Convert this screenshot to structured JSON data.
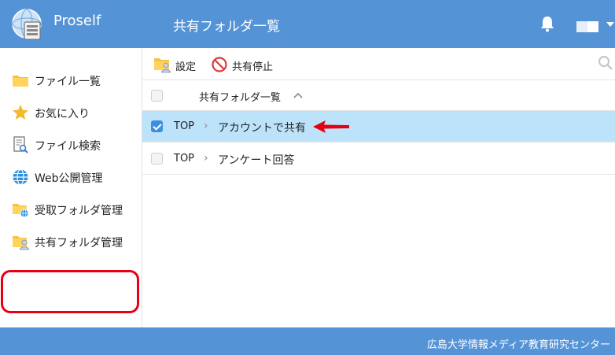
{
  "header": {
    "brand": "Proself",
    "title": "共有フォルダ一覧",
    "bg_color": "#5593d7"
  },
  "sidebar": {
    "items": [
      {
        "label": "ファイル一覧",
        "icon": "folder-icon"
      },
      {
        "label": "お気に入り",
        "icon": "star-icon"
      },
      {
        "label": "ファイル検索",
        "icon": "file-search-icon"
      },
      {
        "label": "Web公開管理",
        "icon": "globe-icon"
      },
      {
        "label": "受取フォルダ管理",
        "icon": "folder-globe-icon"
      },
      {
        "label": "共有フォルダ管理",
        "icon": "shared-folder-icon"
      }
    ],
    "highlight_color": "#e60012"
  },
  "toolbar": {
    "settings_label": "設定",
    "stop_sharing_label": "共有停止"
  },
  "list": {
    "column_title": "共有フォルダ一覧",
    "rows": [
      {
        "root": "TOP",
        "name": "アカウントで共有",
        "checked": true
      },
      {
        "root": "TOP",
        "name": "アンケート回答",
        "checked": false
      }
    ],
    "selected_color": "#bde3fb"
  },
  "footer": {
    "text": "広島大学情報メディア教育研究センター"
  }
}
